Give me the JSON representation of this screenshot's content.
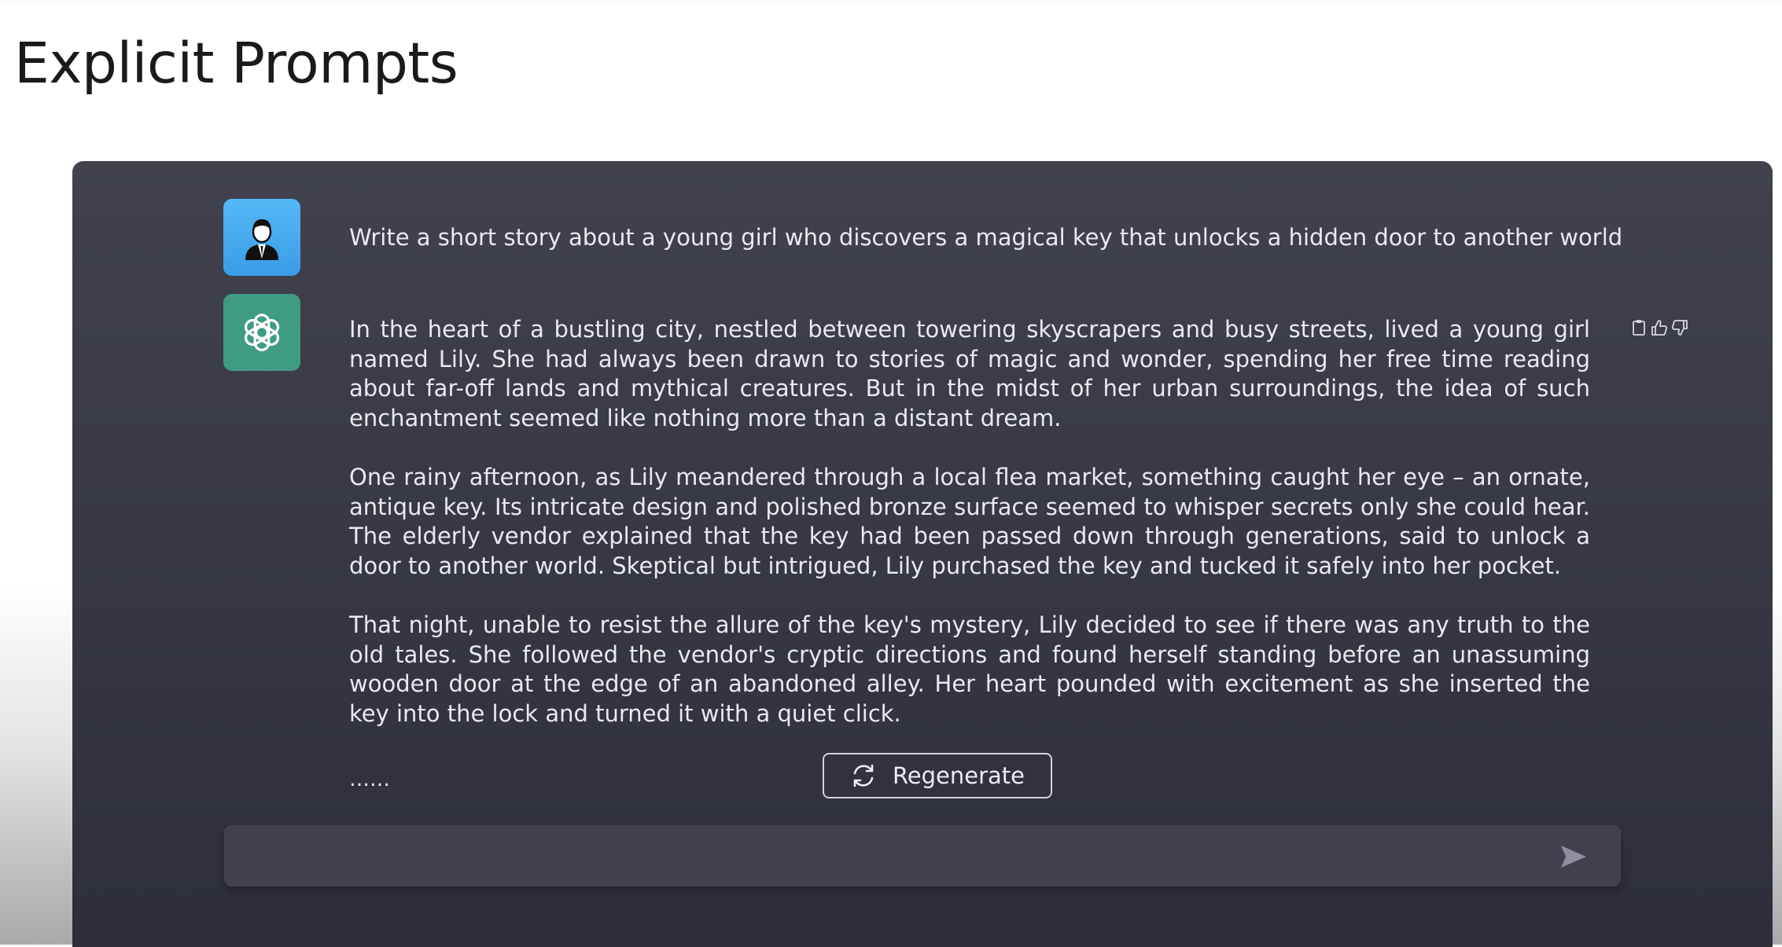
{
  "page": {
    "title": "Explicit Prompts"
  },
  "chat": {
    "user_message": "Write a short story about a young girl who discovers a magical key that unlocks a hidden door to another world",
    "assistant_paragraphs": [
      "In the heart of a bustling city, nestled between towering skyscrapers and busy streets, lived a young girl named Lily. She had always been drawn to stories of magic and wonder, spending her free time reading about far-off lands and mythical creatures. But in the midst of her urban surroundings, the idea of such enchantment seemed like nothing more than a distant dream.",
      "One rainy afternoon, as Lily meandered through a local flea market, something caught her eye – an ornate, antique key. Its intricate design and polished bronze surface seemed to whisper secrets only she could hear. The elderly vendor explained that the key had been passed down through generations, said to unlock a door to another world. Skeptical but intrigued, Lily purchased the key and tucked it safely into her pocket.",
      "That night, unable to resist the allure of the key's mystery, Lily decided to see if there was any truth to the old tales. She followed the vendor's cryptic directions and found herself standing before an unassuming wooden door at the edge of an abandoned alley. Her heart pounded with excitement as she inserted the key into the lock and turned it with a quiet click."
    ],
    "truncation": "……",
    "regenerate_label": "Regenerate",
    "input_value": ""
  },
  "icons": {
    "user_avatar": "user-avatar-icon",
    "assistant_avatar": "openai-logo-icon",
    "copy": "clipboard-icon",
    "thumbs_up": "thumbs-up-icon",
    "thumbs_down": "thumbs-down-icon",
    "regenerate": "refresh-icon",
    "send": "send-icon"
  },
  "colors": {
    "panel_bg": "#373844",
    "user_avatar_bg": "#4aaef2",
    "assistant_avatar_bg": "#409b83",
    "text": "#e9e9ee",
    "input_bg": "#40414d"
  }
}
